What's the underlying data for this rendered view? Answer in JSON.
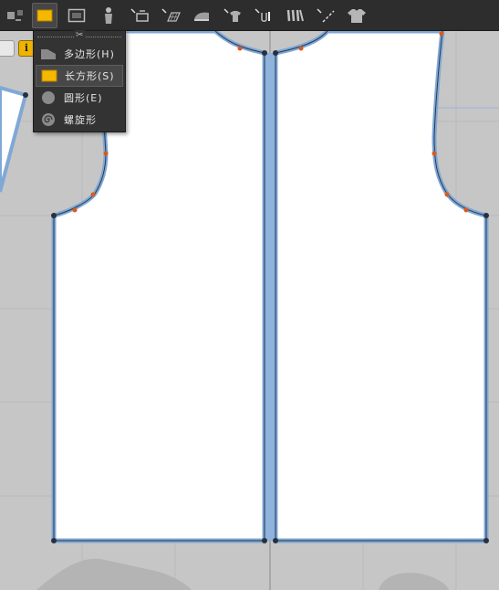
{
  "toolbar": {
    "tools": [
      {
        "id": "select",
        "icon": "transform-pattern-icon"
      },
      {
        "id": "rectangle",
        "icon": "rectangle-tool-icon",
        "active": true
      },
      {
        "id": "internal-rectangle",
        "icon": "internal-rectangle-icon"
      },
      {
        "id": "avatar",
        "icon": "avatar-icon"
      },
      {
        "id": "sewing",
        "icon": "segment-sewing-icon"
      },
      {
        "id": "grid",
        "icon": "grid-icon"
      },
      {
        "id": "steam",
        "icon": "steam-iron-icon"
      },
      {
        "id": "fold",
        "icon": "fold-garment-icon"
      },
      {
        "id": "tack",
        "icon": "tack-icon"
      },
      {
        "id": "pleat",
        "icon": "pleat-icon"
      },
      {
        "id": "line",
        "icon": "line-tool-icon"
      },
      {
        "id": "garment",
        "icon": "tshirt-icon"
      }
    ]
  },
  "dropdown": {
    "items": [
      {
        "label": "多边形(H)",
        "icon": "polygon-icon",
        "selected": false
      },
      {
        "label": "长方形(S)",
        "icon": "rectangle-icon",
        "selected": true
      },
      {
        "label": "圆形(E)",
        "icon": "circle-icon",
        "selected": false
      },
      {
        "label": "螺旋形",
        "icon": "spiral-icon",
        "selected": false
      }
    ]
  },
  "colors": {
    "background": "#c6c6c6",
    "panel": "#2d2d2d",
    "accent_yellow": "#f5b800",
    "seam_blue": "#7fa8d6",
    "point_orange": "#d95a1c",
    "point_dark": "#263040"
  }
}
